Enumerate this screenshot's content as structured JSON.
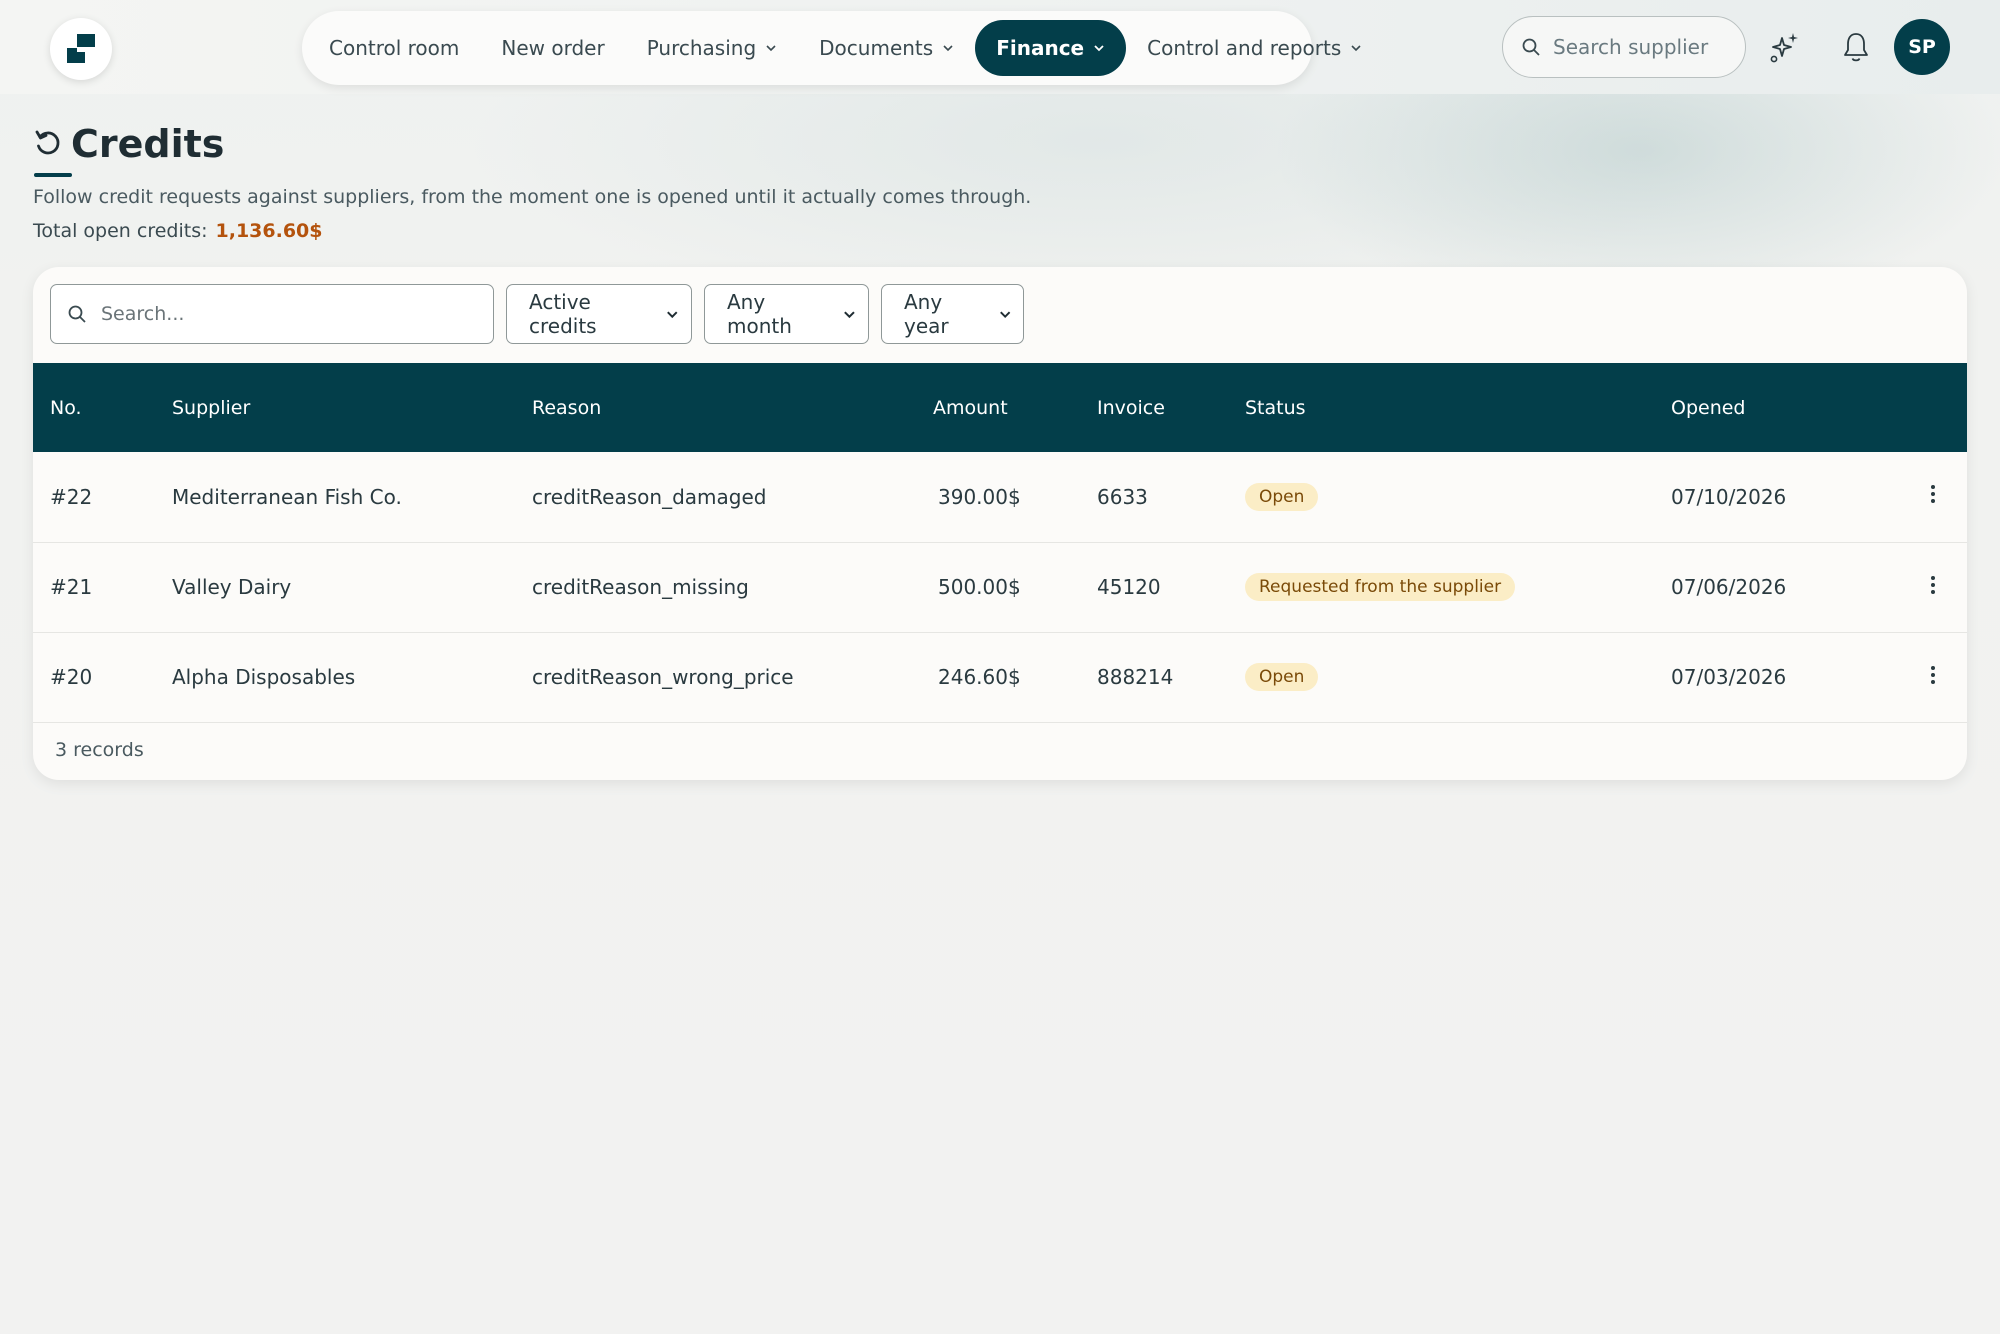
{
  "header": {
    "nav": [
      {
        "label": "Control room",
        "dropdown": false,
        "active": false
      },
      {
        "label": "New order",
        "dropdown": false,
        "active": false
      },
      {
        "label": "Purchasing",
        "dropdown": true,
        "active": false
      },
      {
        "label": "Documents",
        "dropdown": true,
        "active": false
      },
      {
        "label": "Finance",
        "dropdown": true,
        "active": true
      },
      {
        "label": "Control and reports",
        "dropdown": true,
        "active": false
      }
    ],
    "search_placeholder": "Search supplier",
    "avatar_initials": "SP"
  },
  "page": {
    "title": "Credits",
    "subtitle": "Follow credit requests against suppliers, from the moment one is opened until it actually comes through.",
    "total_label": "Total open credits:",
    "total_value": "1,136.60$"
  },
  "filters": {
    "search_placeholder": "Search...",
    "status_select": "Active credits",
    "month_select": "Any month",
    "year_select": "Any year"
  },
  "table": {
    "columns": [
      "No.",
      "Supplier",
      "Reason",
      "Amount",
      "Invoice",
      "Status",
      "Opened"
    ],
    "rows": [
      {
        "no": "#22",
        "supplier": "Mediterranean Fish Co.",
        "reason": "creditReason_damaged",
        "amount": "390.00$",
        "invoice": "6633",
        "status": "Open",
        "opened": "07/10/2026"
      },
      {
        "no": "#21",
        "supplier": "Valley Dairy",
        "reason": "creditReason_missing",
        "amount": "500.00$",
        "invoice": "45120",
        "status": "Requested from the supplier",
        "opened": "07/06/2026"
      },
      {
        "no": "#20",
        "supplier": "Alpha Disposables",
        "reason": "creditReason_wrong_price",
        "amount": "246.60$",
        "invoice": "888214",
        "status": "Open",
        "opened": "07/03/2026"
      }
    ],
    "footer": "3 records"
  },
  "colors": {
    "primary": "#033e4a",
    "accent_amount": "#b4530d",
    "badge_bg": "#fbedc6",
    "badge_text": "#7a4a08"
  }
}
